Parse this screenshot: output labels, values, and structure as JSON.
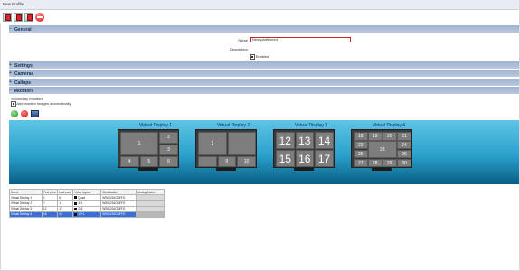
{
  "window": {
    "title": "New Profile"
  },
  "sections": {
    "general": "General",
    "settings": "Settings",
    "cameras": "Cameras",
    "callups": "Callups",
    "monitors": "Monitors"
  },
  "form": {
    "name_label": "Name",
    "name_value": "New partitioned",
    "description_label": "Description",
    "enabled_label": "Enabled",
    "enabled": true
  },
  "monitors_panel": {
    "heading": "Secondary monitors",
    "auto_assign_label": "Add monitor images automatically"
  },
  "displays": [
    {
      "title": "Virtual Display 1",
      "tiles": [
        "1",
        "2",
        "3",
        "4",
        "5",
        "6"
      ]
    },
    {
      "title": "Virtual Display 2",
      "tiles": [
        "1",
        "",
        "",
        "9",
        "10",
        "11"
      ]
    },
    {
      "title": "Virtual Display 3",
      "tiles": [
        "12",
        "13",
        "14",
        "15",
        "16",
        "17"
      ]
    },
    {
      "title": "Virtual Display 4",
      "tiles": [
        "18",
        "19",
        "20",
        "21",
        "22",
        "23",
        "24",
        "25",
        "26",
        "27",
        "28",
        "29",
        "30"
      ]
    }
  ],
  "table": {
    "headers": [
      "Name",
      "First pane",
      "Last pane",
      "Video layout",
      "Workstation",
      "Analog Matrix"
    ],
    "rows": [
      {
        "name": "Virtual Display 1",
        "first": "1",
        "last": "6",
        "layout": "Quad",
        "workstation": "WS01234CDEFG",
        "matrix": ""
      },
      {
        "name": "Virtual Display 2",
        "first": "7",
        "last": "11",
        "layout": "3+1",
        "workstation": "WS01234CDEFG",
        "matrix": ""
      },
      {
        "name": "Virtual Display 3",
        "first": "12",
        "last": "17",
        "layout": "2x3",
        "workstation": "WS01234CDEFG",
        "matrix": ""
      },
      {
        "name": "Virtual Display 4",
        "first": "18",
        "last": "30",
        "layout": "12+1",
        "workstation": "WS01234CDEFG",
        "matrix": ""
      }
    ]
  },
  "colors": {
    "accent_red": "#cc2222",
    "section_blue": "#9fb2d0",
    "display_cyan": "#2aa1cc",
    "selection_blue": "#3a6fd8"
  }
}
